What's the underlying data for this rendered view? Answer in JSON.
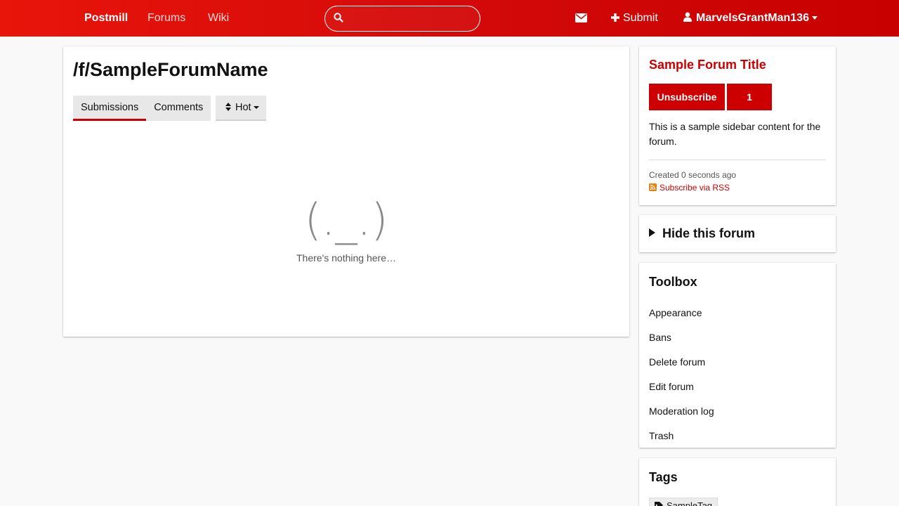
{
  "nav": {
    "brand": "Postmill",
    "forums": "Forums",
    "wiki": "Wiki",
    "search_placeholder": "",
    "submit": "Submit",
    "username": "MarvelsGrantMan136"
  },
  "main": {
    "title": "/f/SampleForumName",
    "tabs": [
      {
        "label": "Submissions",
        "active": true
      },
      {
        "label": "Comments",
        "active": false
      }
    ],
    "sort_label": "Hot",
    "empty_face": "(._.)",
    "empty_text": "There's nothing here…"
  },
  "sidebar": {
    "forum_title": "Sample Forum Title",
    "unsubscribe": "Unsubscribe",
    "subscriber_count": "1",
    "description": "This is a sample sidebar content for the forum.",
    "created": "Created 0 seconds ago",
    "rss": "Subscribe via RSS",
    "hide_label": "Hide this forum",
    "toolbox_heading": "Toolbox",
    "toolbox_items": [
      "Appearance",
      "Bans",
      "Delete forum",
      "Edit forum",
      "Moderation log",
      "Trash"
    ],
    "tags_heading": "Tags",
    "tags": [
      "SampleTag"
    ]
  },
  "colors": {
    "accent": "#cc0000",
    "topbar_start": "#e8150a",
    "topbar_end": "#c80000",
    "background": "#f9f9f9"
  },
  "icons": {
    "search": "search-icon",
    "messages": "envelope-icon",
    "submit": "plus-icon",
    "user": "user-icon",
    "sort": "sort-icon",
    "rss": "rss-icon",
    "tag": "tag-icon"
  }
}
